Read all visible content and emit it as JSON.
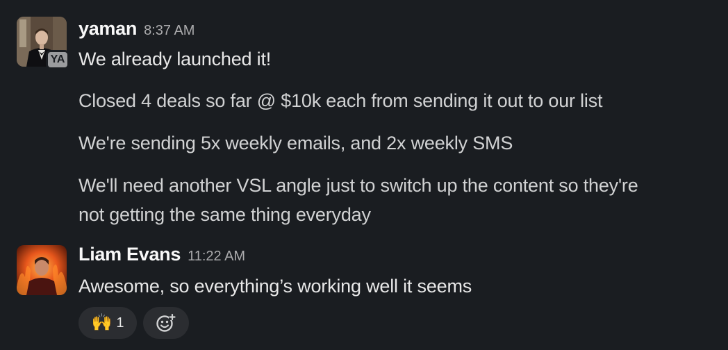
{
  "messages": [
    {
      "author": "yaman",
      "time": "8:37 AM",
      "badge": "YA",
      "lines": [
        "We already launched it!",
        "Closed 4 deals so far @ $10k each from sending it out to our list",
        "We're sending 5x weekly emails, and 2x weekly SMS",
        "We'll need another VSL angle just to switch up the content so they're",
        "not getting the same thing everyday"
      ]
    },
    {
      "author": "Liam Evans",
      "time": "11:22 AM",
      "lines": [
        "Awesome, so everything’s working well it seems"
      ],
      "reactions": [
        {
          "emoji": "🙌",
          "count": "1"
        }
      ]
    }
  ],
  "icons": {
    "add_reaction": "add-reaction-icon"
  },
  "colors": {
    "background": "#1a1d21",
    "name": "#f8f8f8",
    "text": "#d1d2d3",
    "time": "#ababad",
    "reaction_bg": "#2b2d31"
  }
}
